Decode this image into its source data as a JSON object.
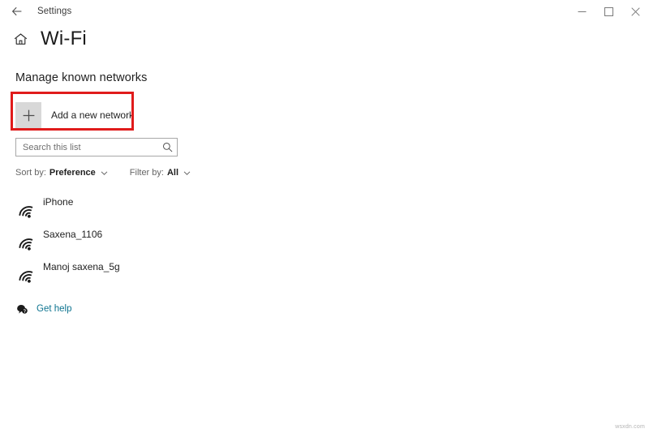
{
  "titlebar": {
    "back_icon": "back-arrow-icon",
    "app_title": "Settings",
    "minimize_label": "minimize-icon",
    "maximize_label": "maximize-icon",
    "close_label": "close-icon"
  },
  "header": {
    "home_icon": "home-icon",
    "title": "Wi-Fi"
  },
  "section": {
    "heading": "Manage known networks"
  },
  "add_network": {
    "plus_icon": "plus-icon",
    "label": "Add a new network"
  },
  "highlight": {
    "color": "#e01b1b"
  },
  "search": {
    "placeholder": "Search this list",
    "value": "",
    "icon": "search-icon"
  },
  "sort_filter": {
    "sort_label": "Sort by:",
    "sort_value": "Preference",
    "filter_label": "Filter by:",
    "filter_value": "All",
    "chevron_icon": "chevron-down-icon"
  },
  "networks": [
    {
      "name": "iPhone",
      "icon": "wifi-icon"
    },
    {
      "name": "Saxena_1106",
      "icon": "wifi-icon"
    },
    {
      "name": "Manoj saxena_5g",
      "icon": "wifi-icon"
    }
  ],
  "get_help": {
    "icon": "help-bubble-icon",
    "label": "Get help",
    "color": "#0e7490"
  },
  "watermark": {
    "text": "wsxdn.com"
  }
}
